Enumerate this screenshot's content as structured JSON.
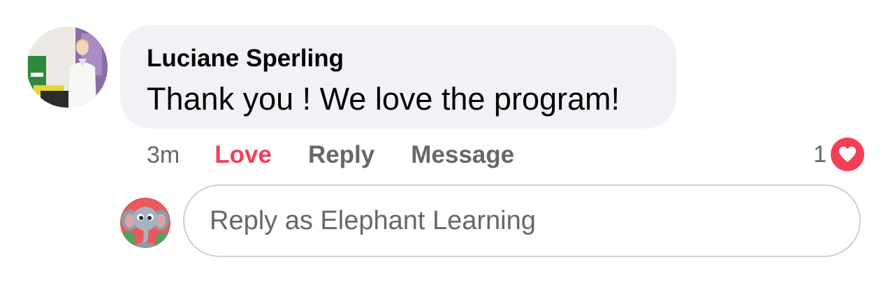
{
  "comment": {
    "author": "Luciane Sperling",
    "text": "Thank you ! We love the program!",
    "time": "3m",
    "actions": {
      "love": "Love",
      "reply": "Reply",
      "message": "Message"
    },
    "reactions": {
      "count": "1",
      "type": "heart-icon",
      "color": "#f33e58"
    }
  },
  "reply_box": {
    "placeholder": "Reply as Elephant Learning"
  },
  "colors": {
    "bubble": "#f0f2f5",
    "secondary_text": "#65676b",
    "love_accent": "#f33e58"
  }
}
